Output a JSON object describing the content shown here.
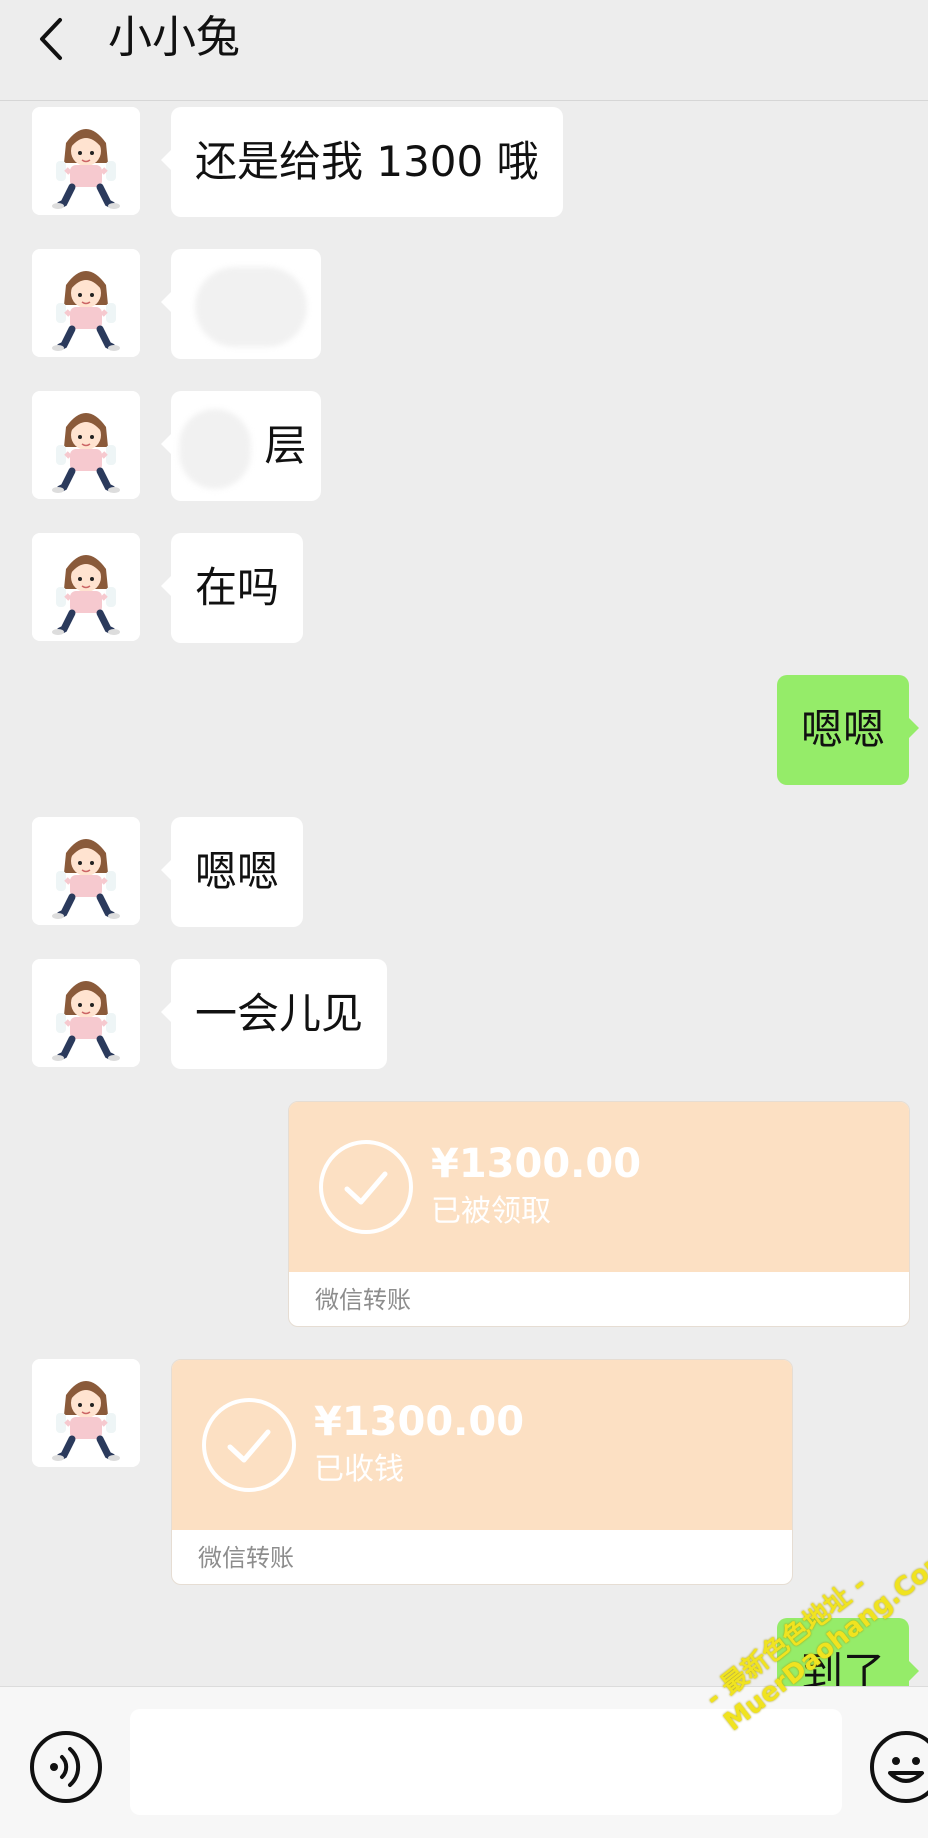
{
  "header": {
    "title": "小小兔"
  },
  "messages": [
    {
      "text": "还是给我 1300 哦"
    },
    {
      "text": ""
    },
    {
      "text": "层"
    },
    {
      "text": "在吗"
    },
    {
      "text": "嗯嗯"
    },
    {
      "text": "嗯嗯"
    },
    {
      "text": "一会儿见"
    },
    {
      "amount": "¥1300.00",
      "status": "已被领取",
      "footer": "微信转账"
    },
    {
      "amount": "¥1300.00",
      "status": "已收钱",
      "footer": "微信转账"
    },
    {
      "text": "到了"
    }
  ],
  "input": {
    "value": ""
  },
  "watermark": {
    "line1": "- 最新色色地址 -",
    "line2": "MuerDaohang.Com"
  },
  "colors": {
    "background": "#ededed",
    "incoming_bubble": "#ffffff",
    "outgoing_bubble": "#95ec69",
    "transfer_card": "#fce0c3"
  },
  "icons": {
    "back": "chevron-left-icon",
    "voice": "voice-icon",
    "emoji": "emoji-icon",
    "check": "check-circle-icon",
    "avatar": "cartoon-girl-avatar"
  }
}
